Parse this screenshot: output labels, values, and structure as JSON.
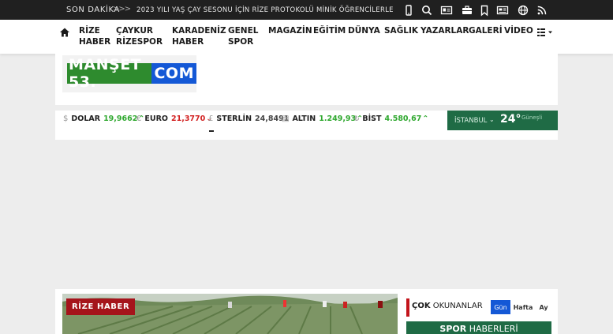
{
  "top_bar": {
    "breaking_label": "SON DAKİKA",
    "arrows": ">>>",
    "headline": "2023 YILI YAŞ ÇAY SESONU İÇİN RİZE PROTOKOLÜ MİNİK ÖĞRENCİLERLE",
    "icons": [
      "mobile-icon",
      "search-icon",
      "id-card-icon",
      "briefcase-icon",
      "bookmark-icon",
      "newspaper-icon",
      "globe-icon",
      "rss-icon"
    ]
  },
  "nav": {
    "items": [
      "RİZE\nHABER",
      "ÇAYKUR\nRİZESPOR",
      "KARADENİZ\nHABER",
      "GENEL\nSPOR",
      "MAGAZİN",
      "EĞİTİM",
      "DÜNYA",
      "SAĞLIK",
      "YAZARLAR",
      "GALERİ",
      "VİDEO"
    ],
    "icons": [
      "home-icon",
      "menu-icon"
    ]
  },
  "logo": {
    "left_text": "MANŞET 53.",
    "right_text": "COM"
  },
  "currencies": [
    {
      "symbol": "$",
      "name": "DOLAR",
      "value": "19,9662",
      "trend": "up"
    },
    {
      "symbol": "€",
      "name": "EURO",
      "value": "21,3770",
      "trend": "down"
    },
    {
      "symbol": "£",
      "name": "STERLİN",
      "value": "24,8491",
      "trend": "neutral"
    },
    {
      "symbol": "▤",
      "name": "ALTIN",
      "value": "1.249,93",
      "trend": "up"
    },
    {
      "symbol": "₺",
      "name": "BİST",
      "value": "4.580,67",
      "trend": "up"
    }
  ],
  "weather": {
    "city": "İSTANBUL",
    "temperature": "24°",
    "condition": "Güneşli"
  },
  "rize_badge": "RİZE HABER",
  "most_read": {
    "title_bold": "ÇOK",
    "title_rest": " OKUNANLAR",
    "tabs": [
      "Gün",
      "Hafta",
      "Ay"
    ],
    "active_tab": 0
  },
  "spor": {
    "bold": "SPOR",
    "rest": " HABERLERİ"
  },
  "colors": {
    "topbar": "#202020",
    "green": "#1f6b45",
    "blue": "#1458d6",
    "red": "#a5141b",
    "up": "#2fa82f",
    "down": "#d21f1f"
  }
}
